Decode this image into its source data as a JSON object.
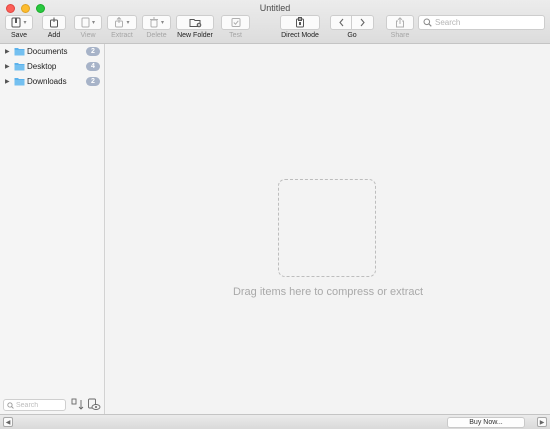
{
  "window": {
    "title": "Untitled"
  },
  "toolbar": {
    "save": "Save",
    "add": "Add",
    "view": "View",
    "extract": "Extract",
    "delete": "Delete",
    "new_folder": "New Folder",
    "test": "Test",
    "direct_mode": "Direct Mode",
    "go": "Go",
    "share": "Share",
    "search_placeholder": "Search"
  },
  "sidebar": {
    "items": [
      {
        "name": "Documents",
        "count": "2",
        "icon": "folder-icon"
      },
      {
        "name": "Desktop",
        "count": "4",
        "icon": "folder-icon"
      },
      {
        "name": "Downloads",
        "count": "2",
        "icon": "folder-icon"
      }
    ],
    "search_placeholder": "Search"
  },
  "main": {
    "drop_text": "Drag items here to compress or extract"
  },
  "statusbar": {
    "buy_label": "Buy Now..."
  },
  "colors": {
    "folder": "#5bb2ec",
    "badge": "#a7b3c8",
    "close": "#fc5f57",
    "minimize": "#fdbc2e",
    "zoom": "#28c840"
  }
}
